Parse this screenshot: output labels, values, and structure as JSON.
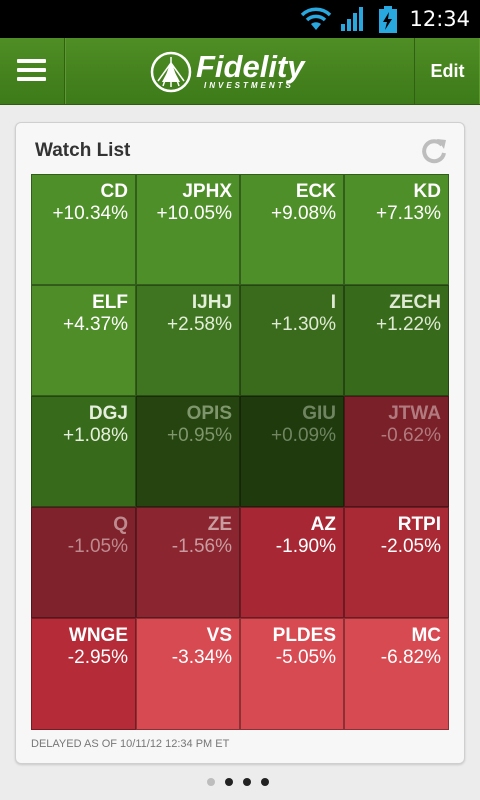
{
  "status_bar": {
    "time": "12:34"
  },
  "header": {
    "menu_icon": "hamburger-menu-icon",
    "logo_text": "Fidelity",
    "logo_subtext": "INVESTMENTS",
    "edit_label": "Edit"
  },
  "watchlist": {
    "title": "Watch List",
    "refresh_icon": "refresh-icon",
    "tiles": [
      {
        "symbol": "CD",
        "change": "+10.34%",
        "bg": "#4f8f2a",
        "fg": "#ffffff"
      },
      {
        "symbol": "JPHX",
        "change": "+10.05%",
        "bg": "#4f8f2a",
        "fg": "#ffffff"
      },
      {
        "symbol": "ECK",
        "change": "+9.08%",
        "bg": "#4f8f2a",
        "fg": "#ffffff"
      },
      {
        "symbol": "KD",
        "change": "+7.13%",
        "bg": "#4f8f2a",
        "fg": "#ffffff"
      },
      {
        "symbol": "ELF",
        "change": "+4.37%",
        "bg": "#4e8d28",
        "fg": "#ffffff"
      },
      {
        "symbol": "IJHJ",
        "change": "+2.58%",
        "bg": "#3f7420",
        "fg": "#e3efd8"
      },
      {
        "symbol": "I",
        "change": "+1.30%",
        "bg": "#3a6b1c",
        "fg": "#dfead4"
      },
      {
        "symbol": "ZECH",
        "change": "+1.22%",
        "bg": "#386a1c",
        "fg": "#dfead4"
      },
      {
        "symbol": "DGJ",
        "change": "+1.08%",
        "bg": "#376a1b",
        "fg": "#e6efde"
      },
      {
        "symbol": "OPIS",
        "change": "+0.95%",
        "bg": "#25440f",
        "fg": "#7f956c"
      },
      {
        "symbol": "GIU",
        "change": "+0.09%",
        "bg": "#1f3a0d",
        "fg": "#6f8460"
      },
      {
        "symbol": "JTWA",
        "change": "-0.62%",
        "bg": "#7a2028",
        "fg": "#b07a7e"
      },
      {
        "symbol": "Q",
        "change": "-1.05%",
        "bg": "#80222b",
        "fg": "#bd8b8f"
      },
      {
        "symbol": "ZE",
        "change": "-1.56%",
        "bg": "#8b2530",
        "fg": "#c99ca0"
      },
      {
        "symbol": "AZ",
        "change": "-1.90%",
        "bg": "#a72834",
        "fg": "#ffffff"
      },
      {
        "symbol": "RTPI",
        "change": "-2.05%",
        "bg": "#a92935",
        "fg": "#ffffff"
      },
      {
        "symbol": "WNGE",
        "change": "-2.95%",
        "bg": "#b52b37",
        "fg": "#ffffff"
      },
      {
        "symbol": "VS",
        "change": "-3.34%",
        "bg": "#d84a52",
        "fg": "#ffffff"
      },
      {
        "symbol": "PLDES",
        "change": "-5.05%",
        "bg": "#d84a52",
        "fg": "#ffffff"
      },
      {
        "symbol": "MC",
        "change": "-6.82%",
        "bg": "#d84a52",
        "fg": "#ffffff"
      }
    ],
    "footer": "DELAYED AS OF 10/11/12 12:34 PM ET"
  },
  "pager": {
    "count": 4,
    "active": 0
  }
}
